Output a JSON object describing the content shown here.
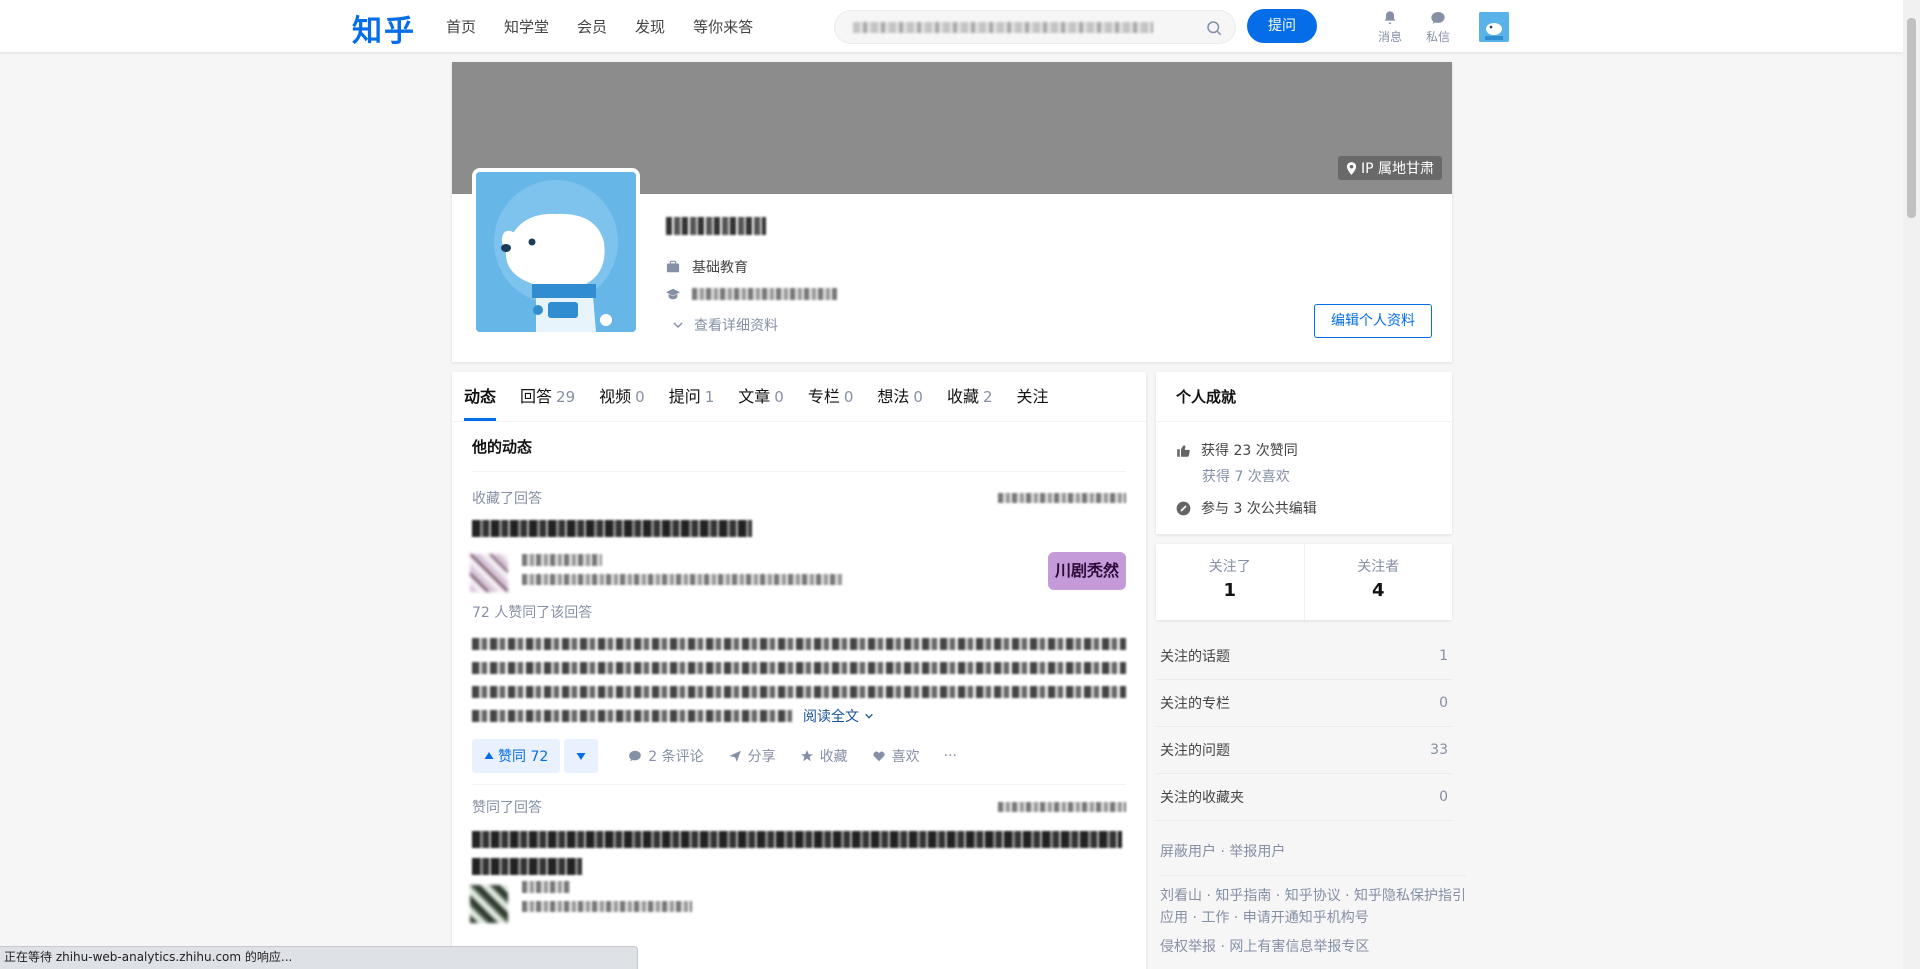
{
  "header": {
    "logo": "知乎",
    "nav": [
      "首页",
      "知学堂",
      "会员",
      "发现",
      "等你来答"
    ],
    "ask_button": "提问",
    "messages_label": "消息",
    "private_label": "私信"
  },
  "profile": {
    "ip_location": "IP 属地甘肃",
    "industry": "基础教育",
    "detail_link": "查看详细资料",
    "edit_button": "编辑个人资料"
  },
  "tabs": [
    {
      "label": "动态",
      "count": ""
    },
    {
      "label": "回答",
      "count": "29"
    },
    {
      "label": "视频",
      "count": "0"
    },
    {
      "label": "提问",
      "count": "1"
    },
    {
      "label": "文章",
      "count": "0"
    },
    {
      "label": "专栏",
      "count": "0"
    },
    {
      "label": "想法",
      "count": "0"
    },
    {
      "label": "收藏",
      "count": "2"
    },
    {
      "label": "关注",
      "count": ""
    }
  ],
  "feed": {
    "section_title": "他的动态",
    "item1": {
      "action": "收藏了回答",
      "vote_info": "72 人赞同了该回答",
      "read_more": "阅读全文",
      "thumb_text": "川剧秃然",
      "vote_label": "赞同 72",
      "comments": "2 条评论",
      "share": "分享",
      "collect": "收藏",
      "like": "喜欢",
      "more": "···"
    },
    "item2": {
      "action": "赞同了回答"
    }
  },
  "sidebar": {
    "achievements_title": "个人成就",
    "upvotes": "获得 23 次赞同",
    "likes": "获得 7 次喜欢",
    "edits": "参与 3 次公共编辑",
    "following_label": "关注了",
    "following_count": "1",
    "followers_label": "关注者",
    "followers_count": "4",
    "lists": [
      {
        "label": "关注的话题",
        "count": "1"
      },
      {
        "label": "关注的专栏",
        "count": "0"
      },
      {
        "label": "关注的问题",
        "count": "33"
      },
      {
        "label": "关注的收藏夹",
        "count": "0"
      }
    ],
    "block_report": "屏蔽用户 · 举报用户",
    "footer_line1": "刘看山 · 知乎指南 · 知乎协议 · 知乎隐私保护指引",
    "footer_line2": "应用 · 工作 · 申请开通知乎机构号",
    "footer_line3": "侵权举报 · 网上有害信息举报专区"
  },
  "status_bar": "正在等待 zhihu-web-analytics.zhihu.com 的响应...",
  "colors": {
    "brand": "#056de8",
    "cover": "#8c8c8c",
    "muted": "#8590a6"
  }
}
